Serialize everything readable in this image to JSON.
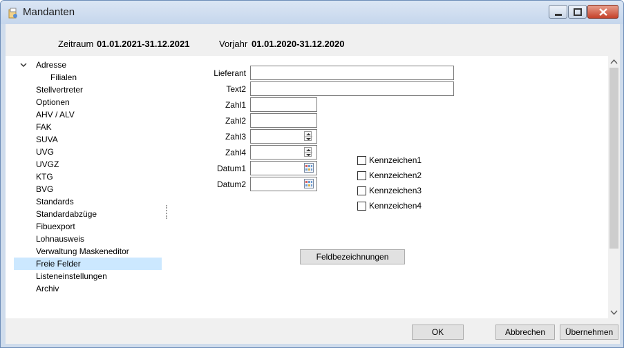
{
  "window": {
    "title": "Mandanten"
  },
  "period": {
    "zeitraum_label": "Zeitraum",
    "zeitraum_value": "01.01.2021-31.12.2021",
    "vorjahr_label": "Vorjahr",
    "vorjahr_value": "01.01.2020-31.12.2020"
  },
  "nav": {
    "items": [
      {
        "label": "Adresse",
        "expanded": true
      },
      {
        "label": "Filialen"
      },
      {
        "label": "Stellvertreter"
      },
      {
        "label": "Optionen"
      },
      {
        "label": "AHV / ALV"
      },
      {
        "label": "FAK"
      },
      {
        "label": "SUVA"
      },
      {
        "label": "UVG"
      },
      {
        "label": "UVGZ"
      },
      {
        "label": "KTG"
      },
      {
        "label": "BVG"
      },
      {
        "label": "Standards"
      },
      {
        "label": "Standardabzüge"
      },
      {
        "label": "Fibuexport"
      },
      {
        "label": "Lohnausweis"
      },
      {
        "label": "Verwaltung Maskeneditor"
      },
      {
        "label": "Freie Felder",
        "selected": true
      },
      {
        "label": "Listeneinstellungen"
      },
      {
        "label": "Archiv"
      }
    ]
  },
  "form": {
    "lieferant": {
      "label": "Lieferant",
      "value": ""
    },
    "text2": {
      "label": "Text2",
      "value": ""
    },
    "zahl1": {
      "label": "Zahl1",
      "value": ""
    },
    "zahl2": {
      "label": "Zahl2",
      "value": ""
    },
    "zahl3": {
      "label": "Zahl3",
      "value": ""
    },
    "zahl4": {
      "label": "Zahl4",
      "value": ""
    },
    "datum1": {
      "label": "Datum1",
      "value": ""
    },
    "datum2": {
      "label": "Datum2",
      "value": ""
    },
    "checkboxes": [
      {
        "label": "Kennzeichen1",
        "checked": false
      },
      {
        "label": "Kennzeichen2",
        "checked": false
      },
      {
        "label": "Kennzeichen3",
        "checked": false
      },
      {
        "label": "Kennzeichen4",
        "checked": false
      }
    ],
    "feldbezeichnungen_label": "Feldbezeichnungen"
  },
  "footer": {
    "ok_label": "OK",
    "cancel_label": "Abbrechen",
    "apply_label": "Übernehmen"
  },
  "colors": {
    "selection": "#cce8ff",
    "titlebar": "#c5d6ec",
    "close_button": "#c5422a"
  },
  "icons": [
    "app-icon",
    "minimize-icon",
    "maximize-icon",
    "close-icon",
    "chevron-down-icon",
    "spin-up-down-icon",
    "calendar-icon",
    "scroll-up-icon",
    "scroll-down-icon"
  ]
}
